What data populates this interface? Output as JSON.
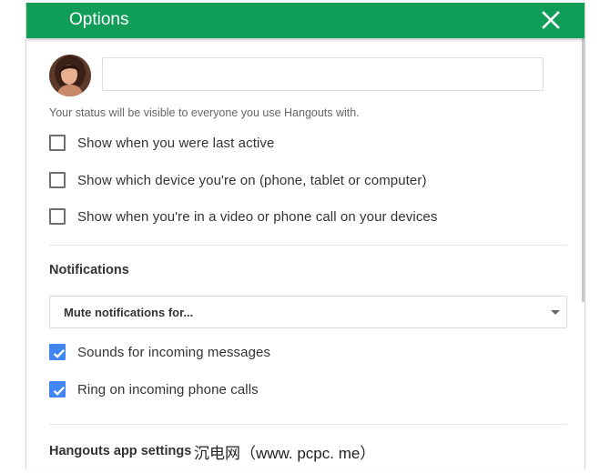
{
  "header": {
    "title": "Options",
    "close_icon": "close-icon",
    "color": "#0f9d58"
  },
  "status": {
    "input_value": "",
    "note": "Your status will be visible to everyone you use Hangouts with."
  },
  "privacy_options": [
    {
      "label": "Show when you were last active",
      "checked": false
    },
    {
      "label": "Show which device you're on (phone, tablet or computer)",
      "checked": false
    },
    {
      "label": "Show when you're in a video or phone call on your devices",
      "checked": false
    }
  ],
  "notifications": {
    "title": "Notifications",
    "dropdown_value": "Mute notifications for...",
    "options": [
      {
        "label": "Sounds for incoming messages",
        "checked": true
      },
      {
        "label": "Ring on incoming phone calls",
        "checked": true
      }
    ]
  },
  "app_settings": {
    "title": "Hangouts app settings"
  },
  "watermark": "沉电网（www. pcpc. me）",
  "accent_color": "#4285f4"
}
